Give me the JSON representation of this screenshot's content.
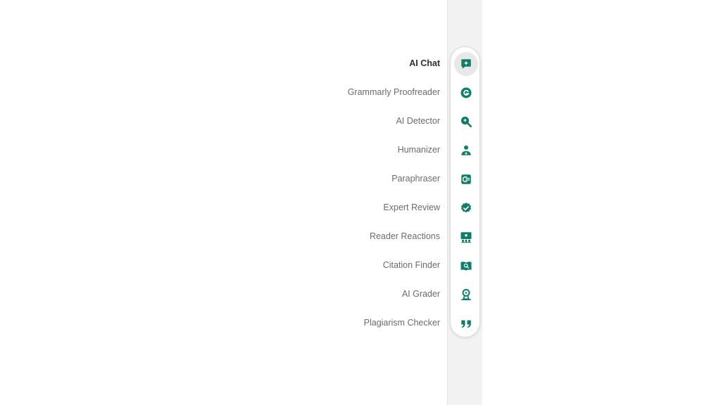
{
  "accent_color": "#0f7d6a",
  "tools": [
    {
      "label": "AI Chat",
      "icon": "ai-chat-icon",
      "active": true
    },
    {
      "label": "Grammarly Proofreader",
      "icon": "grammarly-icon",
      "active": false
    },
    {
      "label": "AI Detector",
      "icon": "ai-detector-icon",
      "active": false
    },
    {
      "label": "Humanizer",
      "icon": "humanizer-icon",
      "active": false
    },
    {
      "label": "Paraphraser",
      "icon": "paraphraser-icon",
      "active": false
    },
    {
      "label": "Expert Review",
      "icon": "expert-review-icon",
      "active": false
    },
    {
      "label": "Reader Reactions",
      "icon": "reader-reactions-icon",
      "active": false
    },
    {
      "label": "Citation Finder",
      "icon": "citation-finder-icon",
      "active": false
    },
    {
      "label": "AI Grader",
      "icon": "ai-grader-icon",
      "active": false
    },
    {
      "label": "Plagiarism Checker",
      "icon": "plagiarism-checker-icon",
      "active": false
    }
  ]
}
